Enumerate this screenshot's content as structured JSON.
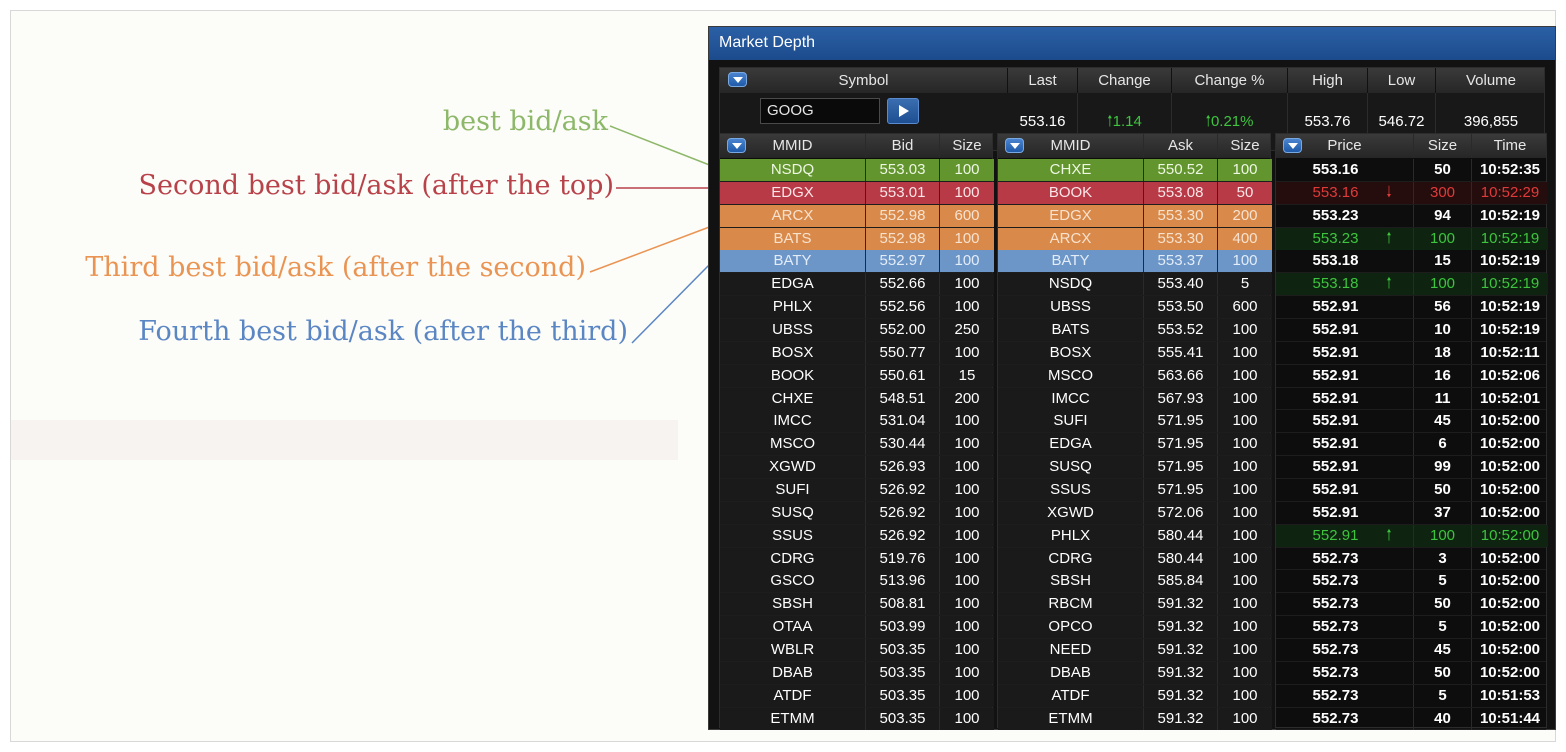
{
  "annotations": {
    "best": "best bid/ask",
    "second": "Second best bid/ask (after the top)",
    "third": "Third best bid/ask (after the second)",
    "fourth": "Fourth best bid/ask (after the third)"
  },
  "colors": {
    "best": "#62952e",
    "second": "#b83a47",
    "third": "#d98a4a",
    "fourth": "#6c95c8",
    "up": "#3ec43e",
    "down": "#e03a3a"
  },
  "window": {
    "title": "Market Depth"
  },
  "quote": {
    "headers": {
      "symbol": "Symbol",
      "last": "Last",
      "change": "Change",
      "change_pct": "Change %",
      "high": "High",
      "low": "Low",
      "volume": "Volume"
    },
    "symbol_input": "GOOG",
    "last": "553.16",
    "change": "1.14",
    "change_pct": "0.21%",
    "high": "553.76",
    "low": "546.72",
    "volume": "396,855"
  },
  "bid_book": {
    "headers": {
      "mmid": "MMID",
      "price": "Bid",
      "size": "Size"
    },
    "rows": [
      {
        "mmid": "NSDQ",
        "price": "553.03",
        "size": "100",
        "level": 1
      },
      {
        "mmid": "EDGX",
        "price": "553.01",
        "size": "100",
        "level": 2
      },
      {
        "mmid": "ARCX",
        "price": "552.98",
        "size": "600",
        "level": 3
      },
      {
        "mmid": "BATS",
        "price": "552.98",
        "size": "100",
        "level": 3
      },
      {
        "mmid": "BATY",
        "price": "552.97",
        "size": "100",
        "level": 4
      },
      {
        "mmid": "EDGA",
        "price": "552.66",
        "size": "100",
        "level": 0
      },
      {
        "mmid": "PHLX",
        "price": "552.56",
        "size": "100",
        "level": 0
      },
      {
        "mmid": "UBSS",
        "price": "552.00",
        "size": "250",
        "level": 0
      },
      {
        "mmid": "BOSX",
        "price": "550.77",
        "size": "100",
        "level": 0
      },
      {
        "mmid": "BOOK",
        "price": "550.61",
        "size": "15",
        "level": 0
      },
      {
        "mmid": "CHXE",
        "price": "548.51",
        "size": "200",
        "level": 0
      },
      {
        "mmid": "IMCC",
        "price": "531.04",
        "size": "100",
        "level": 0
      },
      {
        "mmid": "MSCO",
        "price": "530.44",
        "size": "100",
        "level": 0
      },
      {
        "mmid": "XGWD",
        "price": "526.93",
        "size": "100",
        "level": 0
      },
      {
        "mmid": "SUFI",
        "price": "526.92",
        "size": "100",
        "level": 0
      },
      {
        "mmid": "SUSQ",
        "price": "526.92",
        "size": "100",
        "level": 0
      },
      {
        "mmid": "SSUS",
        "price": "526.92",
        "size": "100",
        "level": 0
      },
      {
        "mmid": "CDRG",
        "price": "519.76",
        "size": "100",
        "level": 0
      },
      {
        "mmid": "GSCO",
        "price": "513.96",
        "size": "100",
        "level": 0
      },
      {
        "mmid": "SBSH",
        "price": "508.81",
        "size": "100",
        "level": 0
      },
      {
        "mmid": "OTAA",
        "price": "503.99",
        "size": "100",
        "level": 0
      },
      {
        "mmid": "WBLR",
        "price": "503.35",
        "size": "100",
        "level": 0
      },
      {
        "mmid": "DBAB",
        "price": "503.35",
        "size": "100",
        "level": 0
      },
      {
        "mmid": "ATDF",
        "price": "503.35",
        "size": "100",
        "level": 0
      },
      {
        "mmid": "ETMM",
        "price": "503.35",
        "size": "100",
        "level": 0
      }
    ]
  },
  "ask_book": {
    "headers": {
      "mmid": "MMID",
      "price": "Ask",
      "size": "Size"
    },
    "rows": [
      {
        "mmid": "CHXE",
        "price": "550.52",
        "size": "100",
        "level": 1
      },
      {
        "mmid": "BOOK",
        "price": "553.08",
        "size": "50",
        "level": 2
      },
      {
        "mmid": "EDGX",
        "price": "553.30",
        "size": "200",
        "level": 3
      },
      {
        "mmid": "ARCX",
        "price": "553.30",
        "size": "400",
        "level": 3
      },
      {
        "mmid": "BATY",
        "price": "553.37",
        "size": "100",
        "level": 4
      },
      {
        "mmid": "NSDQ",
        "price": "553.40",
        "size": "5",
        "level": 0
      },
      {
        "mmid": "UBSS",
        "price": "553.50",
        "size": "600",
        "level": 0
      },
      {
        "mmid": "BATS",
        "price": "553.52",
        "size": "100",
        "level": 0
      },
      {
        "mmid": "BOSX",
        "price": "555.41",
        "size": "100",
        "level": 0
      },
      {
        "mmid": "MSCO",
        "price": "563.66",
        "size": "100",
        "level": 0
      },
      {
        "mmid": "IMCC",
        "price": "567.93",
        "size": "100",
        "level": 0
      },
      {
        "mmid": "SUFI",
        "price": "571.95",
        "size": "100",
        "level": 0
      },
      {
        "mmid": "EDGA",
        "price": "571.95",
        "size": "100",
        "level": 0
      },
      {
        "mmid": "SUSQ",
        "price": "571.95",
        "size": "100",
        "level": 0
      },
      {
        "mmid": "SSUS",
        "price": "571.95",
        "size": "100",
        "level": 0
      },
      {
        "mmid": "XGWD",
        "price": "572.06",
        "size": "100",
        "level": 0
      },
      {
        "mmid": "PHLX",
        "price": "580.44",
        "size": "100",
        "level": 0
      },
      {
        "mmid": "CDRG",
        "price": "580.44",
        "size": "100",
        "level": 0
      },
      {
        "mmid": "SBSH",
        "price": "585.84",
        "size": "100",
        "level": 0
      },
      {
        "mmid": "RBCM",
        "price": "591.32",
        "size": "100",
        "level": 0
      },
      {
        "mmid": "OPCO",
        "price": "591.32",
        "size": "100",
        "level": 0
      },
      {
        "mmid": "NEED",
        "price": "591.32",
        "size": "100",
        "level": 0
      },
      {
        "mmid": "DBAB",
        "price": "591.32",
        "size": "100",
        "level": 0
      },
      {
        "mmid": "ATDF",
        "price": "591.32",
        "size": "100",
        "level": 0
      },
      {
        "mmid": "ETMM",
        "price": "591.32",
        "size": "100",
        "level": 0
      }
    ]
  },
  "time_sales": {
    "headers": {
      "price": "Price",
      "size": "Size",
      "time": "Time"
    },
    "rows": [
      {
        "price": "553.16",
        "size": "50",
        "time": "10:52:35",
        "tick": ""
      },
      {
        "price": "553.16",
        "size": "300",
        "time": "10:52:29",
        "tick": "down"
      },
      {
        "price": "553.23",
        "size": "94",
        "time": "10:52:19",
        "tick": ""
      },
      {
        "price": "553.23",
        "size": "100",
        "time": "10:52:19",
        "tick": "up"
      },
      {
        "price": "553.18",
        "size": "15",
        "time": "10:52:19",
        "tick": ""
      },
      {
        "price": "553.18",
        "size": "100",
        "time": "10:52:19",
        "tick": "up"
      },
      {
        "price": "552.91",
        "size": "56",
        "time": "10:52:19",
        "tick": ""
      },
      {
        "price": "552.91",
        "size": "10",
        "time": "10:52:19",
        "tick": ""
      },
      {
        "price": "552.91",
        "size": "18",
        "time": "10:52:11",
        "tick": ""
      },
      {
        "price": "552.91",
        "size": "16",
        "time": "10:52:06",
        "tick": ""
      },
      {
        "price": "552.91",
        "size": "11",
        "time": "10:52:01",
        "tick": ""
      },
      {
        "price": "552.91",
        "size": "45",
        "time": "10:52:00",
        "tick": ""
      },
      {
        "price": "552.91",
        "size": "6",
        "time": "10:52:00",
        "tick": ""
      },
      {
        "price": "552.91",
        "size": "99",
        "time": "10:52:00",
        "tick": ""
      },
      {
        "price": "552.91",
        "size": "50",
        "time": "10:52:00",
        "tick": ""
      },
      {
        "price": "552.91",
        "size": "37",
        "time": "10:52:00",
        "tick": ""
      },
      {
        "price": "552.91",
        "size": "100",
        "time": "10:52:00",
        "tick": "up"
      },
      {
        "price": "552.73",
        "size": "3",
        "time": "10:52:00",
        "tick": ""
      },
      {
        "price": "552.73",
        "size": "5",
        "time": "10:52:00",
        "tick": ""
      },
      {
        "price": "552.73",
        "size": "50",
        "time": "10:52:00",
        "tick": ""
      },
      {
        "price": "552.73",
        "size": "5",
        "time": "10:52:00",
        "tick": ""
      },
      {
        "price": "552.73",
        "size": "45",
        "time": "10:52:00",
        "tick": ""
      },
      {
        "price": "552.73",
        "size": "50",
        "time": "10:52:00",
        "tick": ""
      },
      {
        "price": "552.73",
        "size": "5",
        "time": "10:51:53",
        "tick": ""
      },
      {
        "price": "552.73",
        "size": "40",
        "time": "10:51:44",
        "tick": ""
      }
    ]
  }
}
